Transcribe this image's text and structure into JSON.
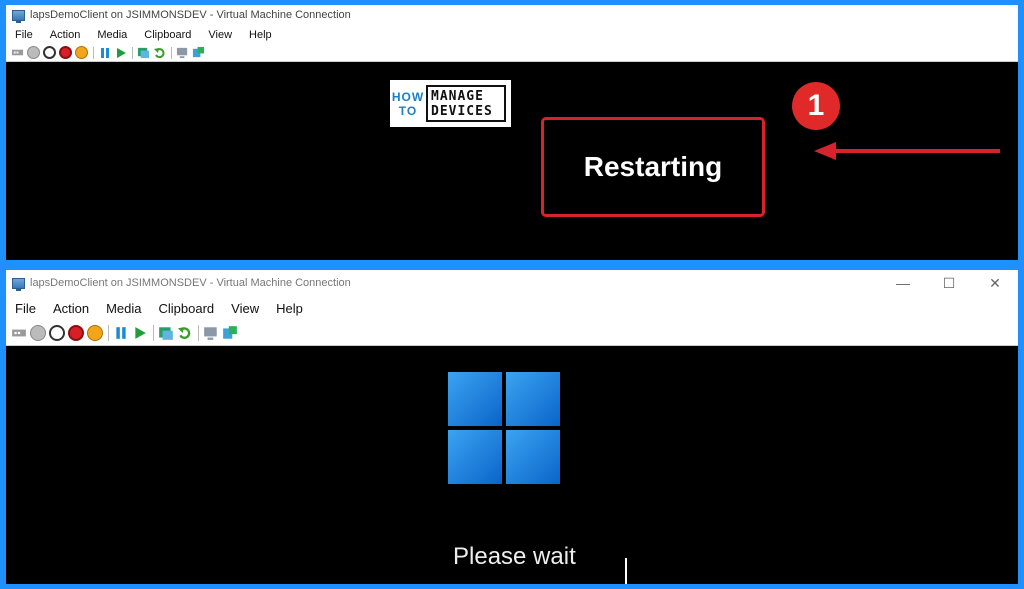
{
  "window_top": {
    "title": "lapsDemoClient on JSIMMONSDEV - Virtual Machine Connection",
    "menu": [
      "File",
      "Action",
      "Media",
      "Clipboard",
      "View",
      "Help"
    ],
    "logo": {
      "line1": "HOW",
      "line2": "TO",
      "line3": "MANAGE",
      "line4": "DEVICES"
    },
    "status_text": "Restarting",
    "callout_number": "1"
  },
  "window_bottom": {
    "title": "lapsDemoClient on JSIMMONSDEV - Virtual Machine Connection",
    "menu": [
      "File",
      "Action",
      "Media",
      "Clipboard",
      "View",
      "Help"
    ],
    "window_controls": {
      "minimize": "—",
      "maximize": "☐",
      "close": "✕"
    },
    "status_text": "Please wait"
  },
  "colors": {
    "frame_blue": "#1e90ff",
    "callout_red": "#d6232e",
    "windows_logo_blue": "#1a7fe0"
  },
  "toolbar_icons": [
    "ctrl-alt-del-icon",
    "start-icon",
    "turn-off-icon",
    "shutdown-icon",
    "save-icon",
    "pause-icon",
    "resume-icon",
    "checkpoint-icon",
    "revert-icon",
    "enhanced-session-icon",
    "share-icon"
  ]
}
